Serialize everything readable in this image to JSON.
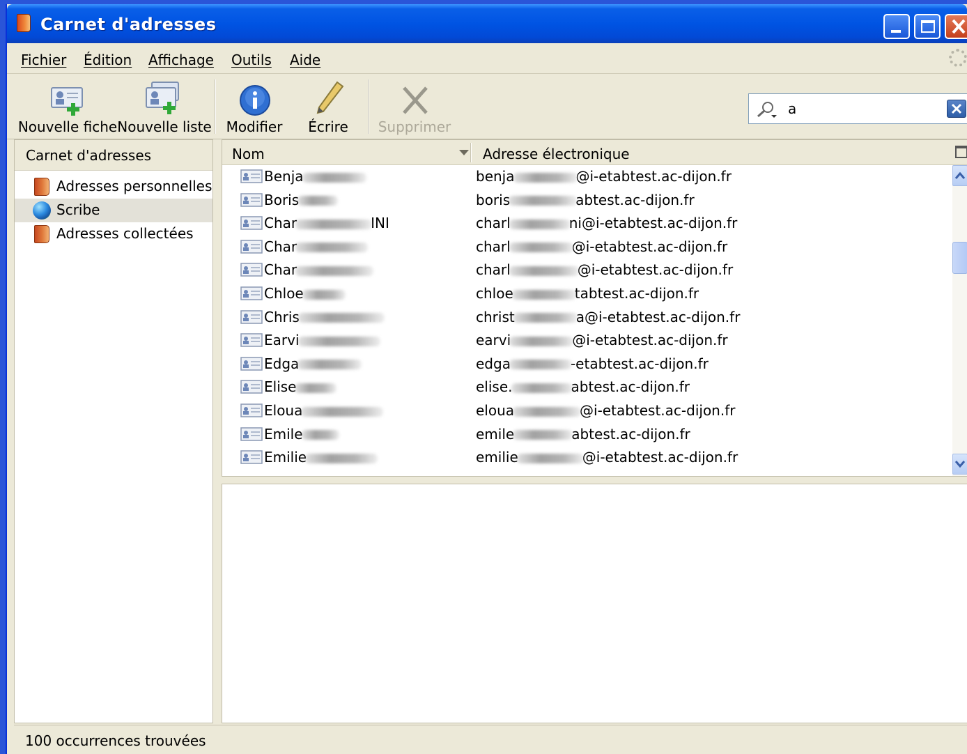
{
  "window": {
    "title": "Carnet d'adresses"
  },
  "menu": [
    "Fichier",
    "Édition",
    "Affichage",
    "Outils",
    "Aide"
  ],
  "toolbar": {
    "new_card": "Nouvelle fiche",
    "new_list": "Nouvelle liste",
    "edit": "Modifier",
    "write": "Écrire",
    "delete": "Supprimer"
  },
  "search": {
    "value": "a"
  },
  "sidebar": {
    "header": "Carnet d'adresses",
    "items": [
      {
        "label": "Adresses personnelles",
        "icon": "address-book-icon"
      },
      {
        "label": "Scribe",
        "icon": "globe-icon"
      },
      {
        "label": "Adresses collectées",
        "icon": "address-book-icon"
      }
    ]
  },
  "list": {
    "columns": {
      "name": "Nom",
      "email": "Adresse électronique"
    },
    "rows": [
      {
        "name_start": "Benja",
        "name_end": "",
        "email_start": "benja",
        "email_end": "@i-etabtest.ac-dijon.fr"
      },
      {
        "name_start": "Boris",
        "name_end": "",
        "email_start": "boris",
        "email_end": "abtest.ac-dijon.fr"
      },
      {
        "name_start": "Char",
        "name_end": "INI",
        "email_start": "charl",
        "email_end": "ni@i-etabtest.ac-dijon.fr"
      },
      {
        "name_start": "Char",
        "name_end": "",
        "email_start": "charl",
        "email_end": "@i-etabtest.ac-dijon.fr"
      },
      {
        "name_start": "Char",
        "name_end": "",
        "email_start": "charl",
        "email_end": "@i-etabtest.ac-dijon.fr"
      },
      {
        "name_start": "Chloe",
        "name_end": "",
        "email_start": "chloe",
        "email_end": "tabtest.ac-dijon.fr"
      },
      {
        "name_start": "Chris",
        "name_end": "",
        "email_start": "christ",
        "email_end": "a@i-etabtest.ac-dijon.fr"
      },
      {
        "name_start": "Earvi",
        "name_end": "",
        "email_start": "earvi",
        "email_end": "@i-etabtest.ac-dijon.fr"
      },
      {
        "name_start": "Edga",
        "name_end": "",
        "email_start": "edga",
        "email_end": "-etabtest.ac-dijon.fr"
      },
      {
        "name_start": "Elise",
        "name_end": "",
        "email_start": "elise.",
        "email_end": "abtest.ac-dijon.fr"
      },
      {
        "name_start": "Eloua",
        "name_end": "",
        "email_start": "eloua",
        "email_end": "@i-etabtest.ac-dijon.fr"
      },
      {
        "name_start": "Emile",
        "name_end": "",
        "email_start": "emile",
        "email_end": "abtest.ac-dijon.fr"
      },
      {
        "name_start": "Emilie",
        "name_end": "",
        "email_start": "emilie",
        "email_end": "@i-etabtest.ac-dijon.fr"
      }
    ]
  },
  "status": {
    "text": "100 occurrences trouvées"
  }
}
